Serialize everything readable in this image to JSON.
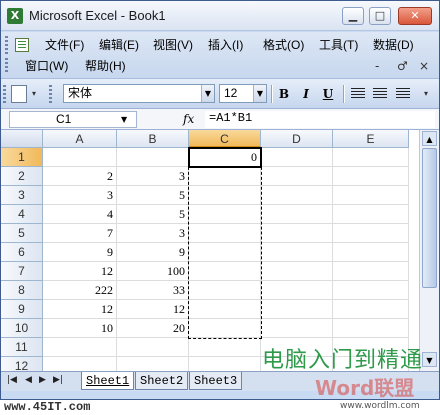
{
  "window": {
    "title": "Microsoft Excel - Book1",
    "app_icon": "X"
  },
  "title_buttons": {
    "minimize": "▁",
    "maximize": "□",
    "close": "✕"
  },
  "menu": {
    "row1": [
      "文件(F)",
      "编辑(E)",
      "视图(V)",
      "插入(I)",
      "格式(O)",
      "工具(T)",
      "数据(D)"
    ],
    "row2": [
      "窗口(W)",
      "帮助(H)"
    ],
    "controls": [
      "-",
      "♂",
      "×"
    ]
  },
  "toolbar": {
    "font_name": "宋体",
    "font_size": "12",
    "bold": "B",
    "italic": "I",
    "underline": "U"
  },
  "formula_bar": {
    "name_box": "C1",
    "fx": "fx",
    "formula": "=A1*B1"
  },
  "grid": {
    "columns": [
      "A",
      "B",
      "C",
      "D",
      "E"
    ],
    "active_column": "C",
    "rows": [
      "1",
      "2",
      "3",
      "4",
      "5",
      "6",
      "7",
      "8",
      "9",
      "10",
      "11",
      "12"
    ],
    "active_row": "1",
    "cells": [
      [
        "",
        "",
        "0",
        "",
        ""
      ],
      [
        "2",
        "3",
        "",
        "",
        ""
      ],
      [
        "3",
        "5",
        "",
        "",
        ""
      ],
      [
        "4",
        "5",
        "",
        "",
        ""
      ],
      [
        "7",
        "3",
        "",
        "",
        ""
      ],
      [
        "9",
        "9",
        "",
        "",
        ""
      ],
      [
        "12",
        "100",
        "",
        "",
        ""
      ],
      [
        "222",
        "33",
        "",
        "",
        ""
      ],
      [
        "12",
        "12",
        "",
        "",
        ""
      ],
      [
        "10",
        "20",
        "",
        "",
        ""
      ],
      [
        "",
        "",
        "",
        "",
        ""
      ],
      [
        "",
        "",
        "",
        "",
        ""
      ]
    ]
  },
  "sheet_tabs": [
    "Sheet1",
    "Sheet2",
    "Sheet3"
  ],
  "active_sheet": "Sheet1",
  "tab_nav": [
    "|◀",
    "◀",
    "▶",
    "▶|"
  ],
  "overlays": {
    "watermark_cn": "电脑入门到精通",
    "watermark_site": "Word联盟",
    "url": "www.45IT.com",
    "url2": "www.wordlm.com"
  },
  "colors": {
    "accent_header": "#f1b95b",
    "frame": "#c9daf3",
    "watermark_green": "#2e9a4a"
  }
}
